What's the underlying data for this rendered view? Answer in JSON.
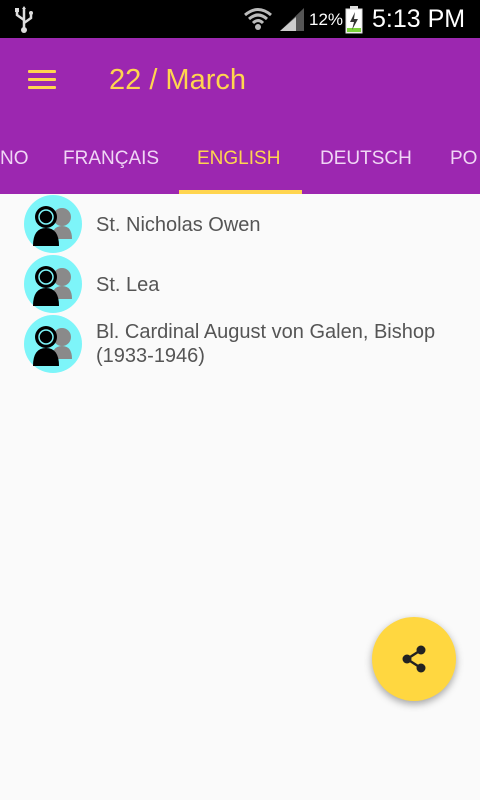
{
  "status_bar": {
    "battery_percent": "12%",
    "time": "5:13 PM",
    "icons": [
      "usb-icon",
      "wifi-icon",
      "signal-icon",
      "battery-charging-icon"
    ]
  },
  "app_bar": {
    "title": "22 / March",
    "menu_icon": "menu-icon",
    "color": "#9c27b0",
    "accent": "#ffd54f"
  },
  "tabs": [
    {
      "label": "NO",
      "active": false
    },
    {
      "label": "FRANÇAIS",
      "active": false
    },
    {
      "label": "ENGLISH",
      "active": true
    },
    {
      "label": "DEUTSCH",
      "active": false
    },
    {
      "label": "PO",
      "active": false
    }
  ],
  "saints": [
    {
      "name": "St. Nicholas Owen",
      "icon": "saint-avatar-icon"
    },
    {
      "name": "St. Lea",
      "icon": "saint-avatar-icon"
    },
    {
      "name": "Bl. Cardinal August von Galen, Bishop (1933-1946)",
      "icon": "saint-avatar-icon"
    }
  ],
  "fab": {
    "icon": "share-icon",
    "color": "#ffd740"
  }
}
